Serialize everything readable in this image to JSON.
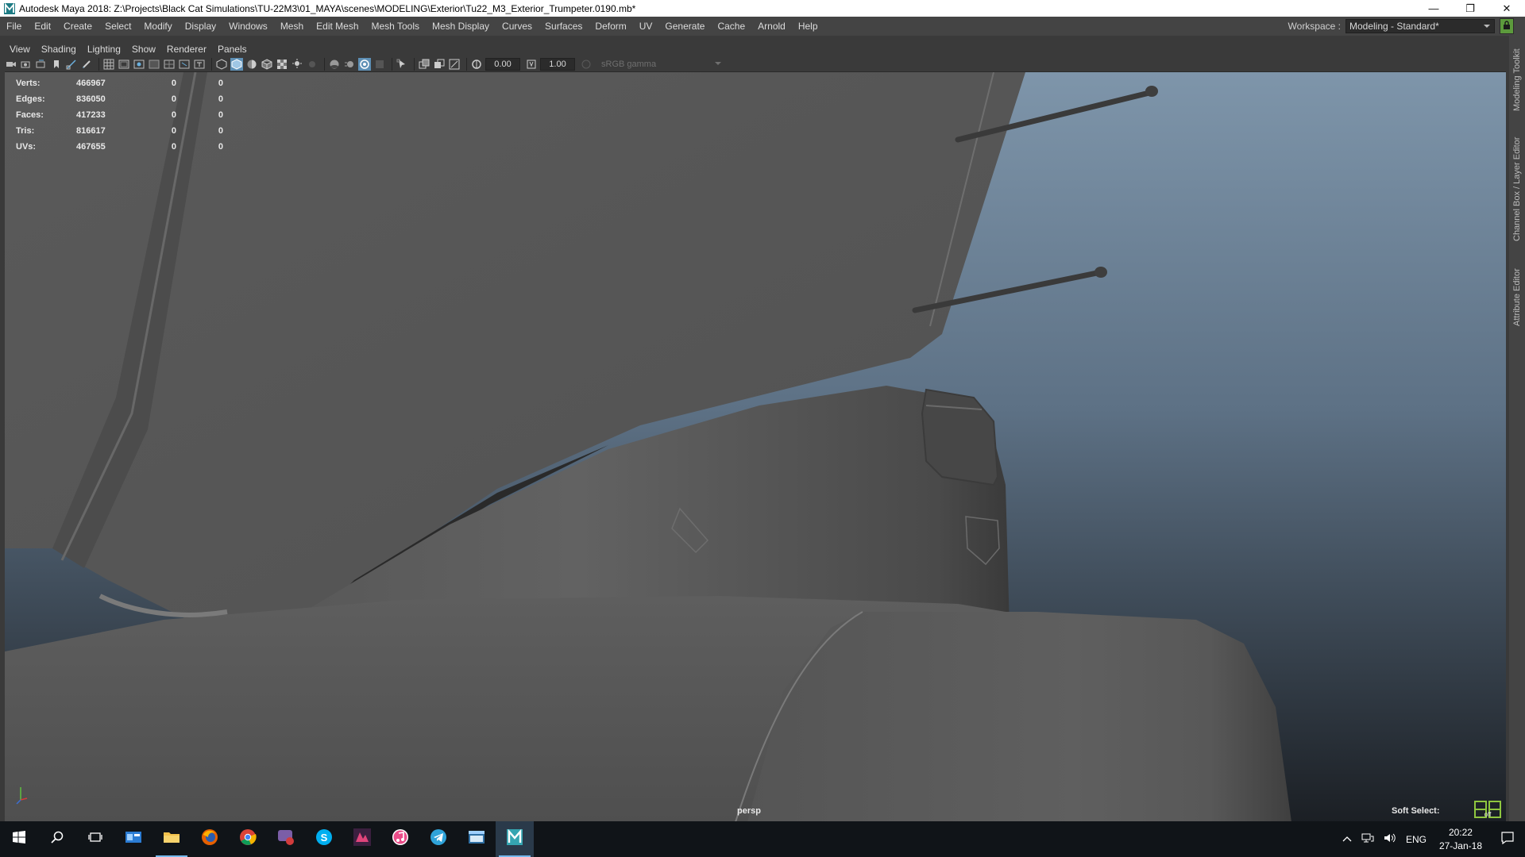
{
  "window": {
    "title": "Autodesk Maya 2018: Z:\\Projects\\Black Cat Simulations\\TU-22M3\\01_MAYA\\scenes\\MODELING\\Exterior\\Tu22_M3_Exterior_Trumpeter.0190.mb*",
    "minimize": "—",
    "restore": "❐",
    "close": "✕"
  },
  "menubar": {
    "items": [
      "File",
      "Edit",
      "Create",
      "Select",
      "Modify",
      "Display",
      "Windows",
      "Mesh",
      "Edit Mesh",
      "Mesh Tools",
      "Mesh Display",
      "Curves",
      "Surfaces",
      "Deform",
      "UV",
      "Generate",
      "Cache",
      "Arnold",
      "Help"
    ]
  },
  "workspace": {
    "label": "Workspace :",
    "value": "Modeling - Standard*"
  },
  "panel_menu": {
    "items": [
      "View",
      "Shading",
      "Lighting",
      "Show",
      "Renderer",
      "Panels"
    ]
  },
  "panel_toolbar": {
    "exposure": "0.00",
    "gamma": "1.00",
    "colorspace": "sRGB gamma"
  },
  "hud": {
    "rows": [
      {
        "label": "Verts:",
        "v1": "466967",
        "v2": "0",
        "v3": "0"
      },
      {
        "label": "Edges:",
        "v1": "836050",
        "v2": "0",
        "v3": "0"
      },
      {
        "label": "Faces:",
        "v1": "417233",
        "v2": "0",
        "v3": "0"
      },
      {
        "label": "Tris:",
        "v1": "816617",
        "v2": "0",
        "v3": "0"
      },
      {
        "label": "UVs:",
        "v1": "467655",
        "v2": "0",
        "v3": "0"
      }
    ]
  },
  "viewport": {
    "camera": "persp",
    "soft_select": "Soft Select:",
    "soft_select_state": "off"
  },
  "side_tabs": [
    "Modeling Toolkit",
    "Channel Box / Layer Editor",
    "Attribute Editor"
  ],
  "taskbar": {
    "apps": [
      {
        "name": "windows-start-icon"
      },
      {
        "name": "search-icon"
      },
      {
        "name": "task-view-icon"
      },
      {
        "name": "explorer-window-icon"
      },
      {
        "name": "file-explorer-icon"
      },
      {
        "name": "firefox-icon"
      },
      {
        "name": "chrome-icon"
      },
      {
        "name": "chat-app-icon"
      },
      {
        "name": "skype-icon"
      },
      {
        "name": "media-app-icon"
      },
      {
        "name": "itunes-icon"
      },
      {
        "name": "telegram-icon"
      },
      {
        "name": "window-app-icon"
      },
      {
        "name": "maya-icon"
      }
    ],
    "language": "ENG",
    "time": "20:22",
    "date": "27-Jan-18"
  },
  "colors": {
    "menu_bg": "#444444",
    "viewport_sky_top": "#7e95aa",
    "viewport_sky_bottom": "#1b1f24",
    "mesh_gray": "#5b5b5b",
    "accent_green": "#8fc63f"
  }
}
